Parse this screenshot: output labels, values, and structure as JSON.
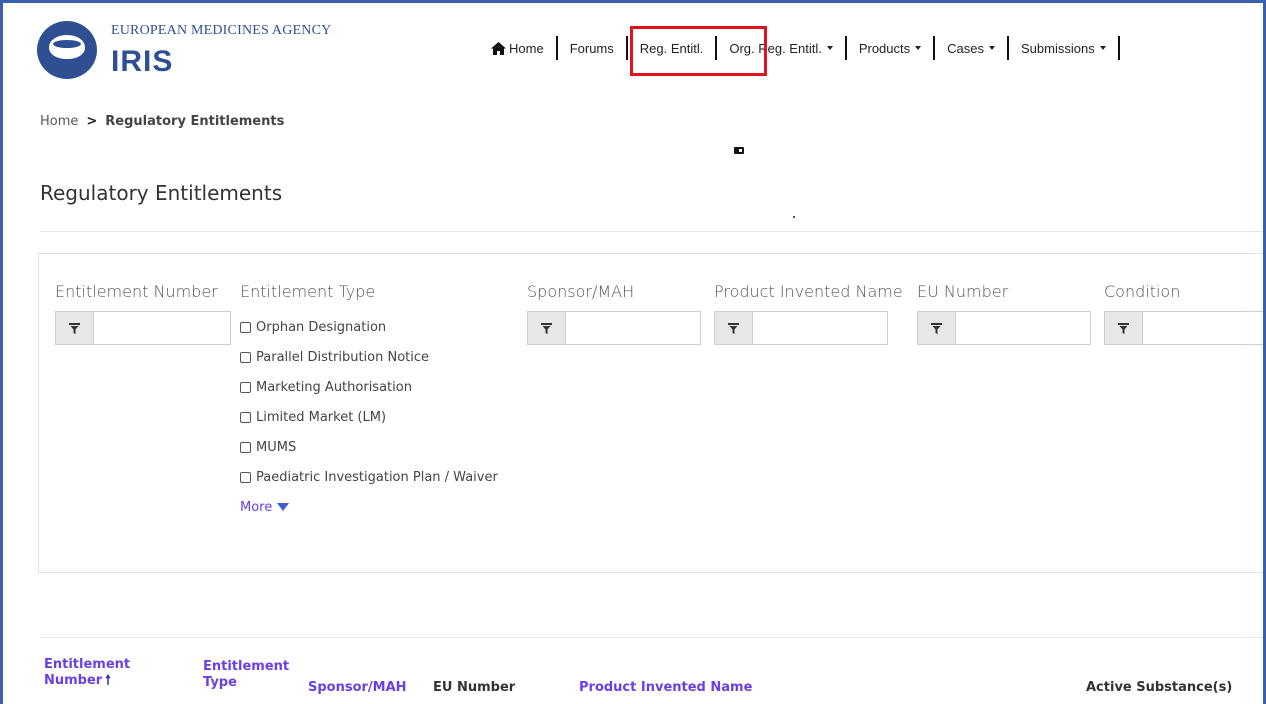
{
  "header": {
    "agency": "EUROPEAN MEDICINES AGENCY",
    "app_name": "IRIS"
  },
  "nav": {
    "home": "Home",
    "forums": "Forums",
    "reg_entitl": "Reg. Entitl.",
    "org_reg_entitl": "Org. Reg. Entitl.",
    "products": "Products",
    "cases": "Cases",
    "submissions": "Submissions",
    "highlight_color": "#e0141c"
  },
  "breadcrumb": {
    "home": "Home",
    "separator": ">",
    "current": "Regulatory Entitlements"
  },
  "page": {
    "title": "Regulatory Entitlements"
  },
  "filters": {
    "entitlement_number": {
      "label": "Entitlement Number",
      "value": ""
    },
    "entitlement_type": {
      "label": "Entitlement Type",
      "options": [
        "Orphan Designation",
        "Parallel Distribution Notice",
        "Marketing Authorisation",
        "Limited Market (LM)",
        "MUMS",
        "Paediatric Investigation Plan / Waiver"
      ],
      "more_label": "More"
    },
    "sponsor_mah": {
      "label": "Sponsor/MAH",
      "value": ""
    },
    "product_invented_name": {
      "label": "Product Invented Name",
      "value": ""
    },
    "eu_number": {
      "label": "EU Number",
      "value": ""
    },
    "condition": {
      "label": "Condition",
      "value": ""
    }
  },
  "table": {
    "columns": {
      "entitlement_number_1": "Entitlement",
      "entitlement_number_2": "Number",
      "entitlement_type_1": "Entitlement",
      "entitlement_type_2": "Type",
      "sponsor_mah": "Sponsor/MAH",
      "eu_number": "EU Number",
      "product_invented_name": "Product Invented Name",
      "active_substances": "Active Substance(s)"
    },
    "sort_indicator": "🠕"
  },
  "colors": {
    "brand": "#2f4f93",
    "link": "#6a3fe6",
    "frame": "#3a5fb0"
  }
}
